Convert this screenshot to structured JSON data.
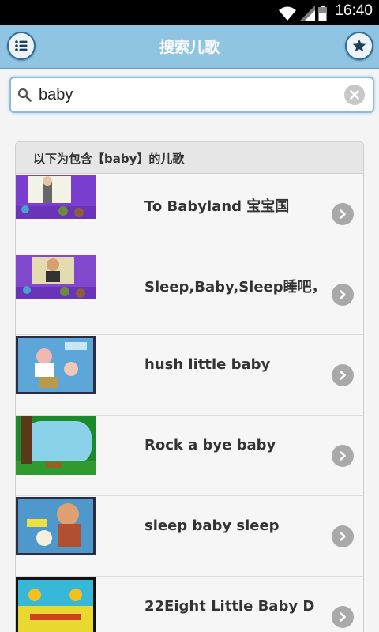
{
  "status_bar": {
    "time": "16:40",
    "icons": [
      "wifi-icon",
      "signal-icon",
      "battery-icon"
    ]
  },
  "header": {
    "title": "搜索儿歌",
    "left_icon": "list-menu-icon",
    "right_icon": "star-icon"
  },
  "search": {
    "value": "baby",
    "icon": "search-icon",
    "clear_icon": "clear-icon"
  },
  "results": {
    "heading": "以下为包含【baby】的儿歌",
    "items": [
      {
        "title": "To Babyland 宝宝国"
      },
      {
        "title": "Sleep,Baby,Sleep睡吧，"
      },
      {
        "title": "hush little baby"
      },
      {
        "title": "Rock a bye baby"
      },
      {
        "title": "sleep baby sleep"
      },
      {
        "title": "22Eight Little Baby D"
      }
    ]
  },
  "colors": {
    "header_bg": "#8fc4e3",
    "accent": "#2f6f99",
    "status_bg": "#000000",
    "panel_bg": "#f6f6f6"
  }
}
